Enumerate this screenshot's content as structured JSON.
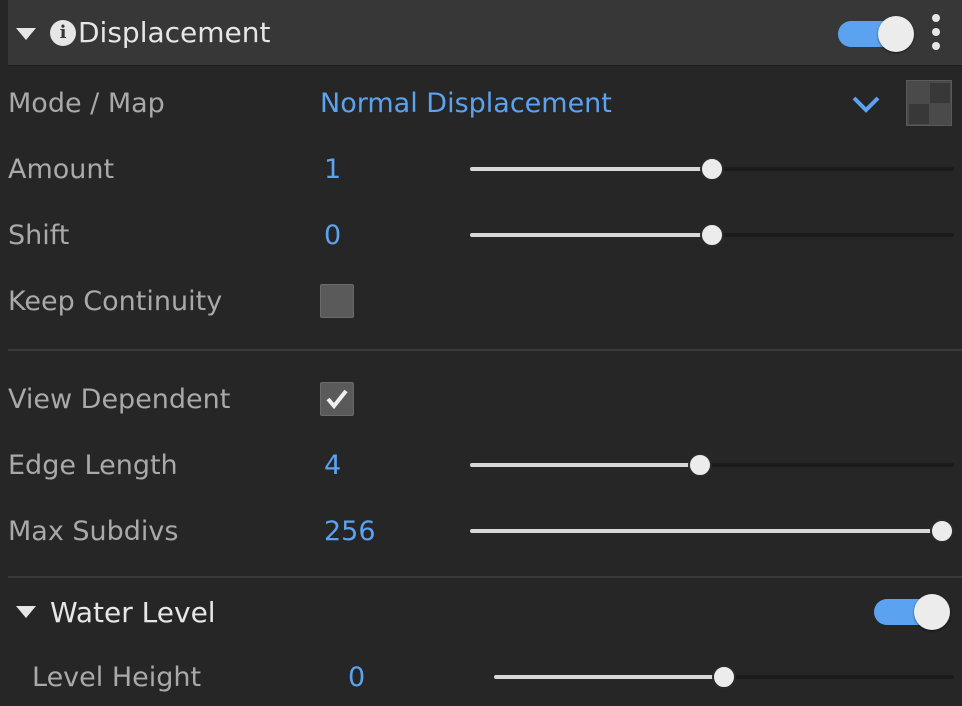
{
  "section": {
    "title": "Displacement",
    "enabled": true
  },
  "rows": {
    "mode": {
      "label": "Mode / Map",
      "value": "Normal Displacement"
    },
    "amount": {
      "label": "Amount",
      "value": "1",
      "slider_fraction": 0.5
    },
    "shift": {
      "label": "Shift",
      "value": "0",
      "slider_fraction": 0.5
    },
    "keep_continuity": {
      "label": "Keep Continuity",
      "checked": false
    },
    "view_dependent": {
      "label": "View Dependent",
      "checked": true
    },
    "edge_length": {
      "label": "Edge Length",
      "value": "4",
      "slider_fraction": 0.475
    },
    "max_subdivs": {
      "label": "Max Subdivs",
      "value": "256",
      "slider_fraction": 1.0
    }
  },
  "water_level": {
    "title": "Water Level",
    "enabled": true,
    "level_height": {
      "label": "Level Height",
      "value": "0",
      "slider_fraction": 0.5
    }
  },
  "icons": {
    "collapse": "triangle-down-icon",
    "info": "info-icon",
    "menu": "kebab-menu-icon",
    "dropdown": "chevron-down-icon",
    "map": "checker-map-icon",
    "check": "checkmark-icon"
  },
  "colors": {
    "accent": "#5ba3f0",
    "background": "#262626",
    "header": "#373737",
    "label": "#a9a9a9"
  }
}
